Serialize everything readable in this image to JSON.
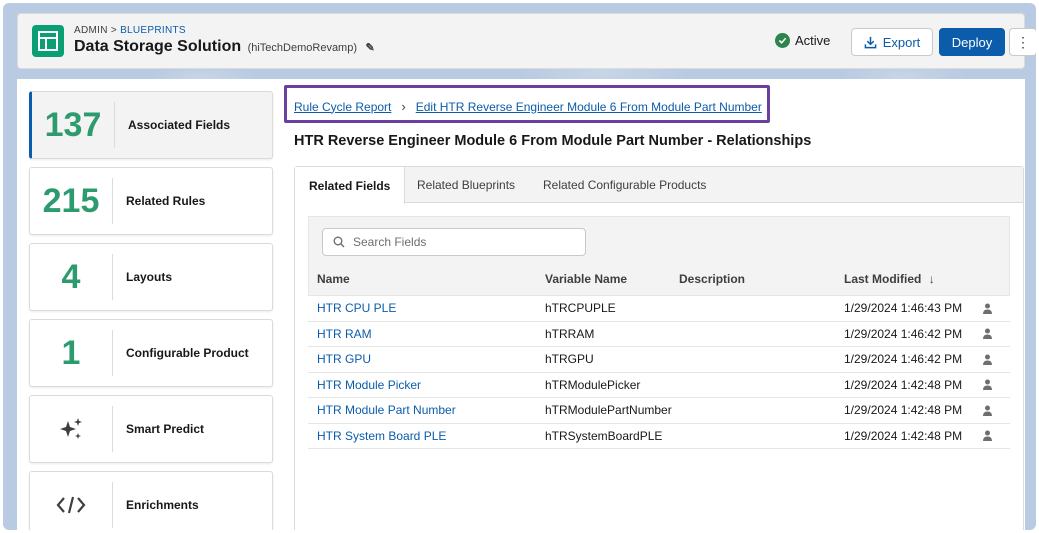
{
  "header": {
    "breadcrumb_root": "ADMIN",
    "breadcrumb_sep": ">",
    "breadcrumb_link": "BLUEPRINTS",
    "title": "Data Storage Solution",
    "subtitle": "(hiTechDemoRevamp)",
    "status": "Active",
    "export_label": "Export",
    "deploy_label": "Deploy"
  },
  "cards": [
    {
      "num": "137",
      "label": "Associated Fields",
      "active": true
    },
    {
      "num": "215",
      "label": "Related Rules"
    },
    {
      "num": "4",
      "label": "Layouts"
    },
    {
      "num": "1",
      "label": "Configurable Product"
    },
    {
      "icon": "sparkles-icon",
      "label": "Smart Predict"
    },
    {
      "icon": "code-icon",
      "label": "Enrichments"
    }
  ],
  "breadcrumb": {
    "first": "Rule Cycle Report",
    "second": "Edit HTR Reverse Engineer Module 6 From Module Part Number"
  },
  "section_title": "HTR Reverse Engineer Module 6 From Module Part Number - Relationships",
  "tabs": [
    "Related Fields",
    "Related Blueprints",
    "Related Configurable Products"
  ],
  "search": {
    "placeholder": "Search Fields"
  },
  "table": {
    "columns": [
      "Name",
      "Variable Name",
      "Description",
      "Last Modified"
    ],
    "rows": [
      {
        "name": "HTR CPU PLE",
        "var": "hTRCPUPLE",
        "date": "1/29/2024 1:46:43 PM"
      },
      {
        "name": "HTR RAM",
        "var": "hTRRAM",
        "date": "1/29/2024 1:46:42 PM"
      },
      {
        "name": "HTR GPU",
        "var": "hTRGPU",
        "date": "1/29/2024 1:46:42 PM"
      },
      {
        "name": "HTR Module Picker",
        "var": "hTRModulePicker",
        "date": "1/29/2024 1:42:48 PM"
      },
      {
        "name": "HTR Module Part Number",
        "var": "hTRModulePartNumber",
        "date": "1/29/2024 1:42:48 PM"
      },
      {
        "name": "HTR System Board PLE",
        "var": "hTRSystemBoardPLE",
        "date": "1/29/2024 1:42:48 PM"
      }
    ]
  },
  "colors": {
    "accent": "#0b5cab",
    "count": "#2e9b6e",
    "highlight": "#6b3fa0",
    "app_icon": "#0a9e74"
  }
}
